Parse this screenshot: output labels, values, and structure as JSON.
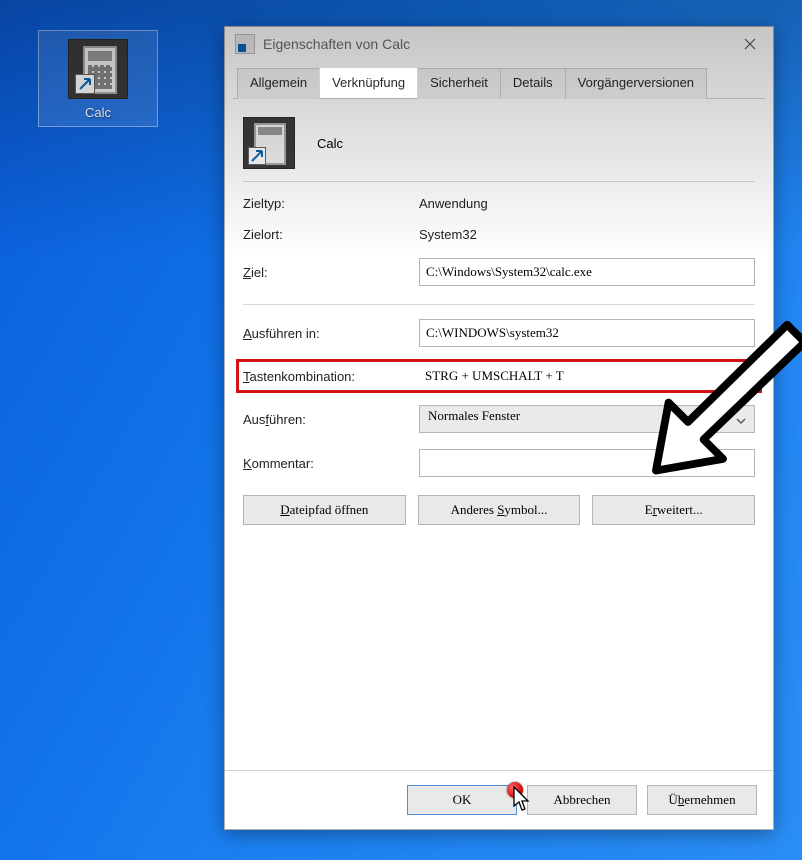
{
  "desktop": {
    "shortcut_label": "Calc"
  },
  "dialog": {
    "title": "Eigenschaften von Calc",
    "tabs": [
      "Allgemein",
      "Verknüpfung",
      "Sicherheit",
      "Details",
      "Vorgängerversionen"
    ],
    "active_tab": 1,
    "app_name": "Calc",
    "labels": {
      "zieltyp": "Zieltyp:",
      "zielort": "Zielort:",
      "ziel": "Ziel:",
      "ausfuehren_in": "Ausführen in:",
      "tastenkombination": "Tastenkombination:",
      "ausfuehren": "Ausführen:",
      "kommentar": "Kommentar:"
    },
    "values": {
      "zieltyp": "Anwendung",
      "zielort": "System32",
      "ziel": "C:\\Windows\\System32\\calc.exe",
      "ausfuehren_in": "C:\\WINDOWS\\system32",
      "tastenkombination": "STRG + UMSCHALT + T",
      "ausfuehren": "Normales Fenster",
      "kommentar": ""
    },
    "buttons": {
      "dateipfad": "Dateipfad öffnen",
      "symbol": "Anderes Symbol...",
      "erweitert": "Erweitert...",
      "ok": "OK",
      "abbrechen": "Abbrechen",
      "uebernehmen": "Übernehmen"
    }
  }
}
